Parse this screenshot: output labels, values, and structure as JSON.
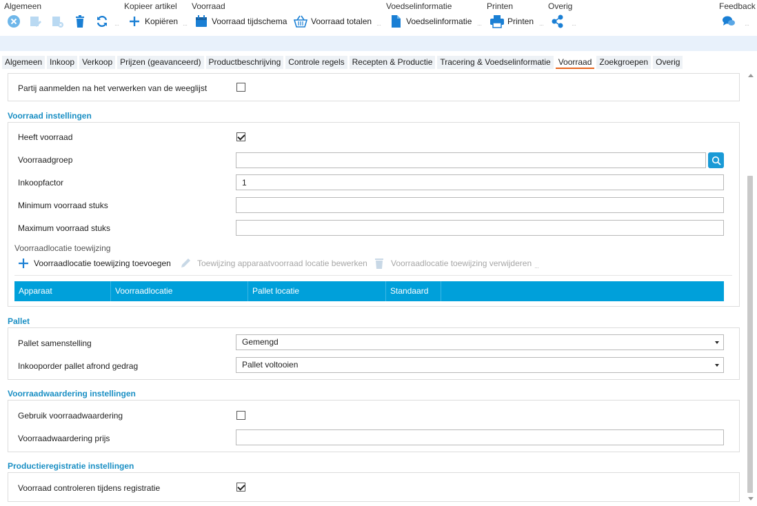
{
  "ribbon": {
    "groups": {
      "algemeen": "Algemeen",
      "kopieer": "Kopieer artikel",
      "voorraad": "Voorraad",
      "voedsel": "Voedselinformatie",
      "printen": "Printen",
      "overig": "Overig",
      "feedback": "Feedback"
    },
    "buttons": {
      "kopieren": "Kopiëren",
      "voorraad_tijdschema": "Voorraad tijdschema",
      "voorraad_totalen": "Voorraad totalen",
      "voedselinformatie": "Voedselinformatie",
      "printen": "Printen"
    }
  },
  "tabs": [
    {
      "label": "Algemeen"
    },
    {
      "label": "Inkoop"
    },
    {
      "label": "Verkoop"
    },
    {
      "label": "Prijzen (geavanceerd)"
    },
    {
      "label": "Productbeschrijving"
    },
    {
      "label": "Controle regels"
    },
    {
      "label": "Recepten & Productie"
    },
    {
      "label": "Tracering & Voedselinformatie"
    },
    {
      "label": "Voorraad",
      "active": true
    },
    {
      "label": "Zoekgroepen"
    },
    {
      "label": "Overig"
    }
  ],
  "top_panel": {
    "partij_label": "Partij aanmelden na het verwerken van de weeglijst",
    "partij_checked": false
  },
  "voorraad": {
    "title": "Voorraad instellingen",
    "heeft_voorraad_label": "Heeft voorraad",
    "heeft_voorraad_checked": true,
    "voorraadgroep_label": "Voorraadgroep",
    "voorraadgroep_value": "",
    "inkoopfactor_label": "Inkoopfactor",
    "inkoopfactor_value": "1",
    "min_label": "Minimum voorraad stuks",
    "min_value": "",
    "max_label": "Maximum voorraad stuks",
    "max_value": "",
    "toewijzing_label": "Voorraadlocatie toewijzing",
    "toolbar": {
      "add": "Voorraadlocatie toewijzing toevoegen",
      "edit": "Toewijzing apparaatvoorraad locatie bewerken",
      "delete": "Voorraadlocatie toewijzing verwijderen"
    },
    "grid_columns": [
      "Apparaat",
      "Voorraadlocatie",
      "Pallet locatie",
      "Standaard"
    ]
  },
  "pallet": {
    "title": "Pallet",
    "samenstelling_label": "Pallet samenstelling",
    "samenstelling_value": "Gemengd",
    "afrond_label": "Inkooporder pallet afrond gedrag",
    "afrond_value": "Pallet voltooien"
  },
  "waardering": {
    "title": "Voorraadwaardering instellingen",
    "gebruik_label": "Gebruik voorraadwaardering",
    "gebruik_checked": false,
    "prijs_label": "Voorraadwaardering prijs",
    "prijs_value": ""
  },
  "productie": {
    "title": "Productieregistratie instellingen",
    "controleren_label": "Voorraad controleren tijdens registratie",
    "controleren_checked": true
  },
  "colors": {
    "accent": "#1a8fc4",
    "grid_header": "#00a0da",
    "active_tab_underline": "#e8641b",
    "icon_blue": "#1a7fd4"
  }
}
